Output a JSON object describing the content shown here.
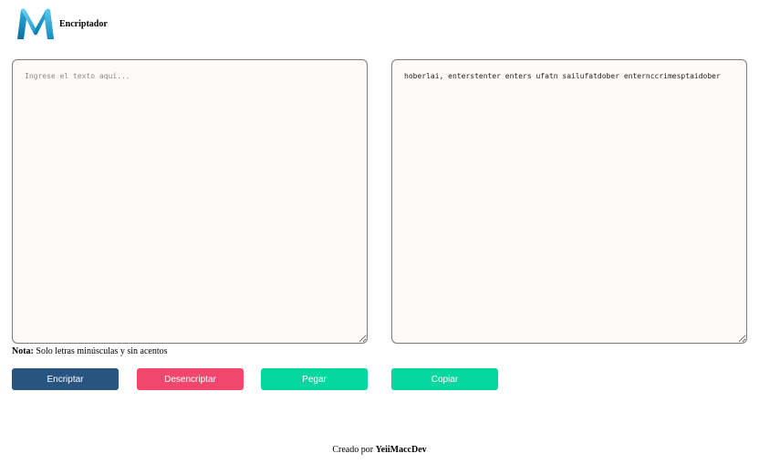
{
  "header": {
    "brand": "Encriptador",
    "logo_colors": [
      "#1f9fd6",
      "#0a6e9e",
      "#7fd8f2"
    ]
  },
  "input": {
    "placeholder": "Ingrese el texto aquí...",
    "value": ""
  },
  "output": {
    "value": "hoberlai, enterstenter enters ufatn sailufatdober enternccrimesptaidober"
  },
  "note": {
    "label": "Nota:",
    "text": " Solo letras minúsculas y sin acentos"
  },
  "buttons": {
    "encrypt": "Encriptar",
    "decrypt": "Desencriptar",
    "paste": "Pegar",
    "copy": "Copiar"
  },
  "colors": {
    "encrypt": "#275480",
    "decrypt": "#f1476f",
    "paste": "#06d6a0",
    "copy": "#06d6a0"
  },
  "footer": {
    "prefix": "Creado por ",
    "author": "YeiiMaccDev"
  }
}
